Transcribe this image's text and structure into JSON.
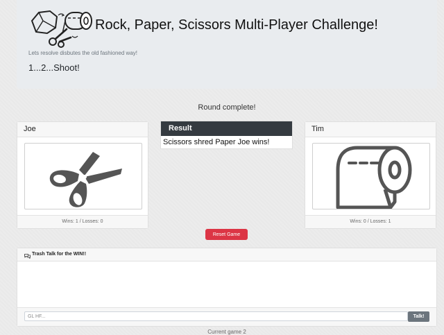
{
  "header": {
    "title": "Rock, Paper, Scissors Multi-Player Challenge!",
    "tagline": "Lets resolve disbutes the old fashioned way!",
    "countdown": "1...2...Shoot!",
    "logo_icon": "rock-paper-scissors-logo-icon"
  },
  "status": "Round complete!",
  "player1": {
    "name": "Joe",
    "choice_icon": "scissors-icon",
    "record": "Wins: 1 / Losses: 0"
  },
  "result": {
    "label": "Result",
    "text": "Scissors shred Paper Joe wins!"
  },
  "player2": {
    "name": "Tim",
    "choice_icon": "paper-icon",
    "record": "Wins: 0 / Losses: 1"
  },
  "reset_label": "Reset Game",
  "chat": {
    "title": "Trash Talk for the WIN!!",
    "icon": "chat-bubbles-icon",
    "placeholder": "GL HF...",
    "send_label": "Talk!"
  },
  "turn_text": "Current game 2",
  "colors": {
    "result_header": "#343a40",
    "reset_button": "#dc3545",
    "talk_button": "#6c757d",
    "icon": "#555555"
  }
}
